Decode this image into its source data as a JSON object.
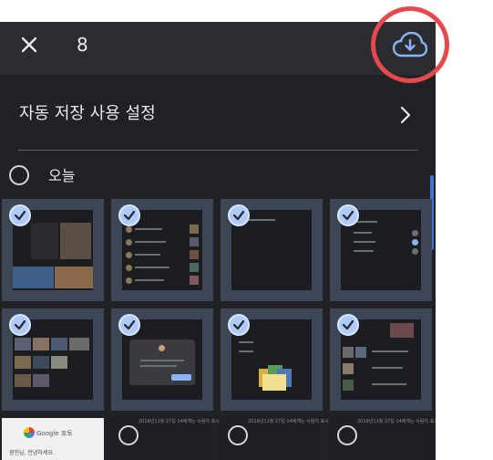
{
  "header": {
    "close_icon": "close-icon",
    "selected_count": "8",
    "cloud_icon": "cloud-download-icon"
  },
  "settings": {
    "label": "자동 저장 사용 설정",
    "chevron_icon": "chevron-right-icon"
  },
  "section": {
    "label": "오늘"
  },
  "thumb_captions": {
    "caption_1": "2019년11월 27일 14에게는 사람의 포시",
    "caption_2": "2019년11월 27일 14에게는 사람의 표시",
    "google_label": "Google 포토",
    "google_sub": "광진님, 안녕하세요."
  },
  "colors": {
    "accent": "#aecbfa",
    "tile_bg": "#3d4557",
    "cloud": "#8ab4f8",
    "highlight": "#e5484d",
    "scrollbar": "#3b74d4"
  },
  "tiles": [
    {
      "selected": true
    },
    {
      "selected": true
    },
    {
      "selected": true
    },
    {
      "selected": true
    },
    {
      "selected": true
    },
    {
      "selected": true
    },
    {
      "selected": true
    },
    {
      "selected": true
    },
    {
      "selected": false
    },
    {
      "selected": false
    },
    {
      "selected": false
    },
    {
      "selected": false
    }
  ]
}
